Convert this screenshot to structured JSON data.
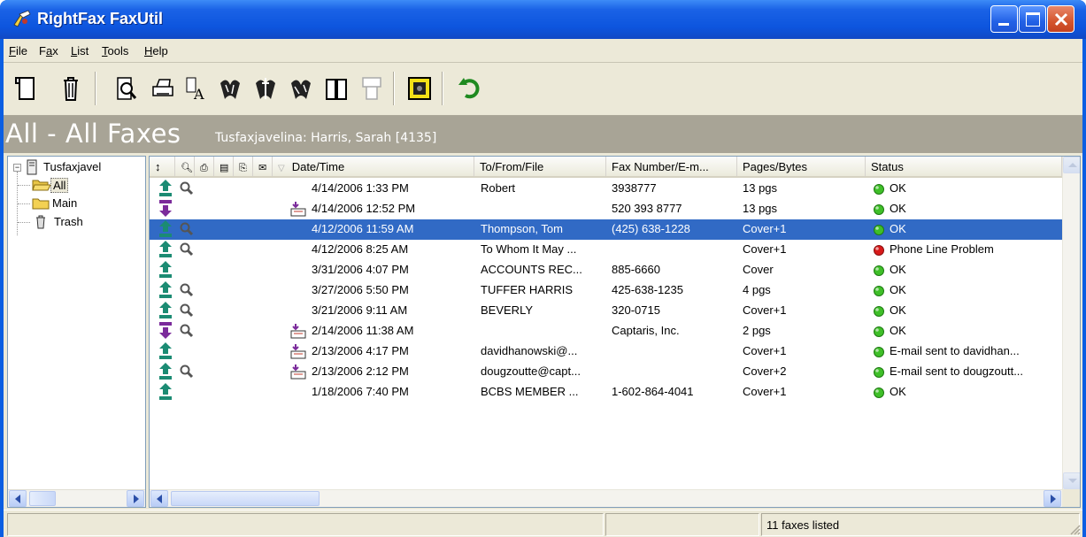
{
  "window": {
    "title": "RightFax FaxUtil"
  },
  "menu": {
    "file": "File",
    "fax": "Fax",
    "list": "List",
    "tools": "Tools",
    "help": "Help"
  },
  "banner": {
    "title": "All - All Faxes",
    "subtitle": "Tusfaxjavelina: Harris, Sarah  [4135]"
  },
  "tree": {
    "root": "Tusfaxjavel",
    "items": [
      "All",
      "Main",
      "Trash"
    ],
    "selected": "All"
  },
  "columns": {
    "date": "Date/Time",
    "to": "To/From/File",
    "fax": "Fax Number/E-m...",
    "pages": "Pages/Bytes",
    "status": "Status"
  },
  "rows": [
    {
      "dir": "out",
      "view": true,
      "recv": false,
      "date": "4/14/2006 1:33 PM",
      "to": "Robert",
      "fax": "3938777",
      "pages": "13 pgs",
      "status": "OK",
      "state": "ok"
    },
    {
      "dir": "in",
      "view": false,
      "recv": true,
      "date": "4/14/2006 12:52 PM",
      "to": "",
      "fax": "520 393 8777",
      "pages": "13 pgs",
      "status": "OK",
      "state": "ok"
    },
    {
      "dir": "out",
      "view": true,
      "recv": false,
      "date": "4/12/2006 11:59 AM",
      "to": "Thompson, Tom",
      "fax": "(425) 638-1228",
      "pages": "Cover+1",
      "status": "OK",
      "state": "ok",
      "selected": true
    },
    {
      "dir": "out",
      "view": true,
      "recv": false,
      "date": "4/12/2006 8:25 AM",
      "to": "To Whom It May ...",
      "fax": "",
      "pages": "Cover+1",
      "status": "Phone Line Problem",
      "state": "error"
    },
    {
      "dir": "out",
      "view": false,
      "recv": false,
      "date": "3/31/2006 4:07 PM",
      "to": "ACCOUNTS REC...",
      "fax": "885-6660",
      "pages": "Cover",
      "status": "OK",
      "state": "ok"
    },
    {
      "dir": "out",
      "view": true,
      "recv": false,
      "date": "3/27/2006 5:50 PM",
      "to": "TUFFER HARRIS",
      "fax": "425-638-1235",
      "pages": "4 pgs",
      "status": "OK",
      "state": "ok"
    },
    {
      "dir": "out",
      "view": true,
      "recv": false,
      "date": "3/21/2006 9:11 AM",
      "to": "BEVERLY",
      "fax": "320-0715",
      "pages": "Cover+1",
      "status": "OK",
      "state": "ok"
    },
    {
      "dir": "in",
      "view": true,
      "recv": true,
      "date": "2/14/2006 11:38 AM",
      "to": "",
      "fax": "Captaris, Inc.",
      "pages": "2 pgs",
      "status": "OK",
      "state": "ok"
    },
    {
      "dir": "out",
      "view": false,
      "recv": true,
      "date": "2/13/2006 4:17 PM",
      "to": "davidhanowski@...",
      "fax": "",
      "pages": "Cover+1",
      "status": "E-mail sent to davidhan...",
      "state": "ok"
    },
    {
      "dir": "out",
      "view": true,
      "recv": true,
      "date": "2/13/2006 2:12 PM",
      "to": "dougzoutte@capt...",
      "fax": "",
      "pages": "Cover+2",
      "status": "E-mail sent to dougzoutt...",
      "state": "ok"
    },
    {
      "dir": "out",
      "view": false,
      "recv": false,
      "date": "1/18/2006 7:40 PM",
      "to": "BCBS MEMBER ...",
      "fax": "1-602-864-4041",
      "pages": "Cover+1",
      "status": "OK",
      "state": "ok"
    }
  ],
  "status": {
    "count": "11 faxes listed"
  },
  "colors": {
    "title_bar": "#0b5ee2",
    "banner": "#a8a496",
    "selection": "#316ac5",
    "ok": "#3fbf28",
    "error": "#d81a1a"
  },
  "toolbar_icons": [
    "new-fax-icon",
    "delete-icon",
    "view-icon",
    "print-icon",
    "font-icon",
    "forward-icon",
    "route-icon",
    "send-again-icon",
    "book-icon",
    "disabled-page-icon",
    "monitor-icon",
    "refresh-icon"
  ]
}
